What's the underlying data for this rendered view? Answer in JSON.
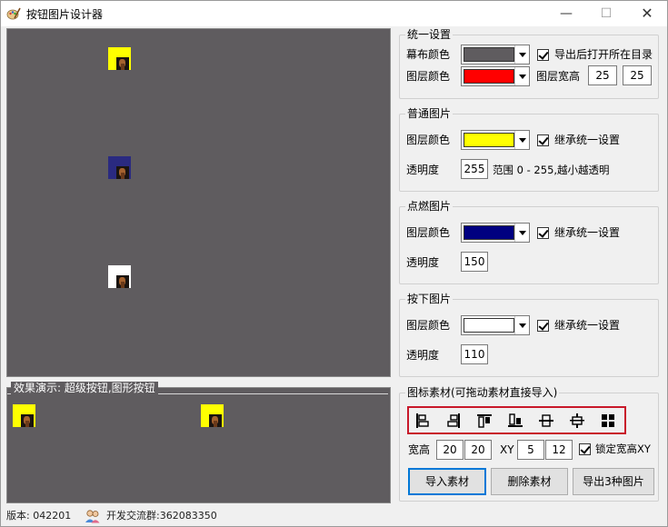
{
  "window": {
    "title": "按钮图片设计器",
    "minimize": "—",
    "maximize": "☐",
    "close": "✕"
  },
  "unified": {
    "legend": "统一设置",
    "canvas_color_label": "幕布颜色",
    "canvas_color": "#5f5c5f",
    "layer_color_label": "图层颜色",
    "layer_color": "#ff0000",
    "open_dir_label": "导出后打开所在目录",
    "size_label": "图层宽高",
    "width": "25",
    "height": "25"
  },
  "normal": {
    "legend": "普通图片",
    "layer_color_label": "图层颜色",
    "layer_color": "#ffff00",
    "inherit_label": "继承统一设置",
    "opacity_label": "透明度",
    "opacity": "255",
    "range_label": "范围 0 - 255,越小越透明"
  },
  "hover": {
    "legend": "点燃图片",
    "layer_color_label": "图层颜色",
    "layer_color": "#000080",
    "inherit_label": "继承统一设置",
    "opacity_label": "透明度",
    "opacity": "150"
  },
  "pressed": {
    "legend": "按下图片",
    "layer_color_label": "图层颜色",
    "layer_color": "#ffffff",
    "inherit_label": "继承统一设置",
    "opacity_label": "透明度",
    "opacity": "110"
  },
  "material": {
    "legend": "图标素材(可拖动素材直接导入)",
    "size_label": "宽高",
    "w": "20",
    "h": "20",
    "xy_label": "XY",
    "x": "5",
    "y": "12",
    "lock_label": "锁定宽高XY",
    "tools": [
      "align-left-icon",
      "align-right-icon",
      "align-top-icon",
      "align-bottom-icon",
      "center-horizontal-icon",
      "center-vertical-icon",
      "grid-icon"
    ],
    "import_button": "导入素材",
    "delete_button": "删除素材",
    "export_button": "导出3种图片"
  },
  "demo": {
    "legend": "效果演示: 超级按钮,图形按钮",
    "colors": [
      "#ffff00",
      "#ffff00"
    ]
  },
  "preview_colors": [
    "#ffff00",
    "#2a2a80",
    "#ffffff"
  ],
  "status": {
    "version": "版本: 042201",
    "group": "开发交流群:362083350"
  }
}
